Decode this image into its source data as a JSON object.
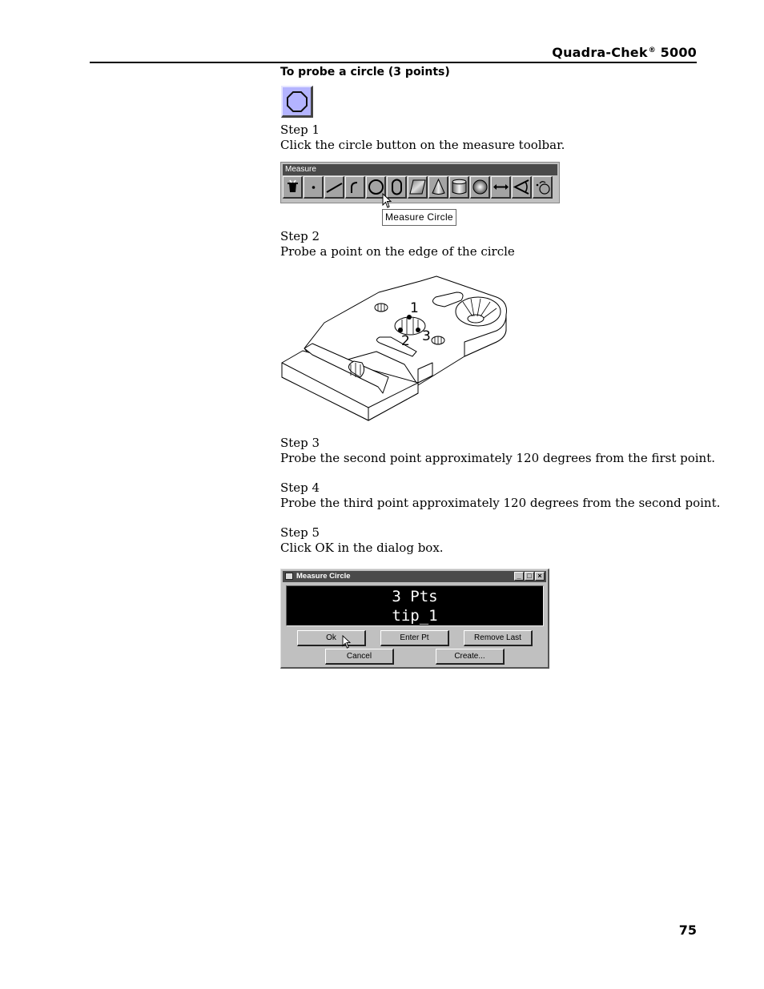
{
  "header": {
    "title": "Quadra-Chek",
    "registered_mark": "®",
    "model": " 5000"
  },
  "section_title": "To probe a circle (3 points)",
  "circle_button_icon": "circle-measure-icon",
  "steps": [
    {
      "label": "Step 1",
      "text": "Click the circle button on the measure toolbar."
    },
    {
      "label": "Step 2",
      "text": "Probe a point on the edge of the circle"
    },
    {
      "label": "Step 3",
      "text": "Probe the second point approximately 120 degrees from the first point."
    },
    {
      "label": "Step 4",
      "text": "Probe the third point approximately 120 degrees from the second point."
    },
    {
      "label": "Step 5",
      "text": "Click OK in the dialog box."
    }
  ],
  "toolbar": {
    "title": "Measure",
    "tools": [
      {
        "icon": "magic-hat-icon"
      },
      {
        "icon": "point-icon"
      },
      {
        "icon": "line-icon"
      },
      {
        "icon": "arc-icon"
      },
      {
        "icon": "circle-icon"
      },
      {
        "icon": "slot-icon"
      },
      {
        "icon": "plane-icon"
      },
      {
        "icon": "cone-icon"
      },
      {
        "icon": "cylinder-icon"
      },
      {
        "icon": "sphere-icon"
      },
      {
        "icon": "distance-icon"
      },
      {
        "icon": "angle-icon"
      },
      {
        "icon": "circle-pattern-icon"
      }
    ],
    "tooltip": "Measure Circle"
  },
  "illustration": {
    "point_labels": [
      "1",
      "2",
      "3"
    ]
  },
  "dialog": {
    "title": "Measure Circle",
    "display_line1": "3 Pts",
    "display_line2": "tip_1",
    "buttons": {
      "ok": "Ok",
      "enter_pt": "Enter Pt",
      "remove_last": "Remove Last",
      "cancel": "Cancel",
      "create": "Create..."
    },
    "window_buttons": {
      "minimize": "_",
      "maximize": "□",
      "close": "×"
    }
  },
  "page_number": "75"
}
